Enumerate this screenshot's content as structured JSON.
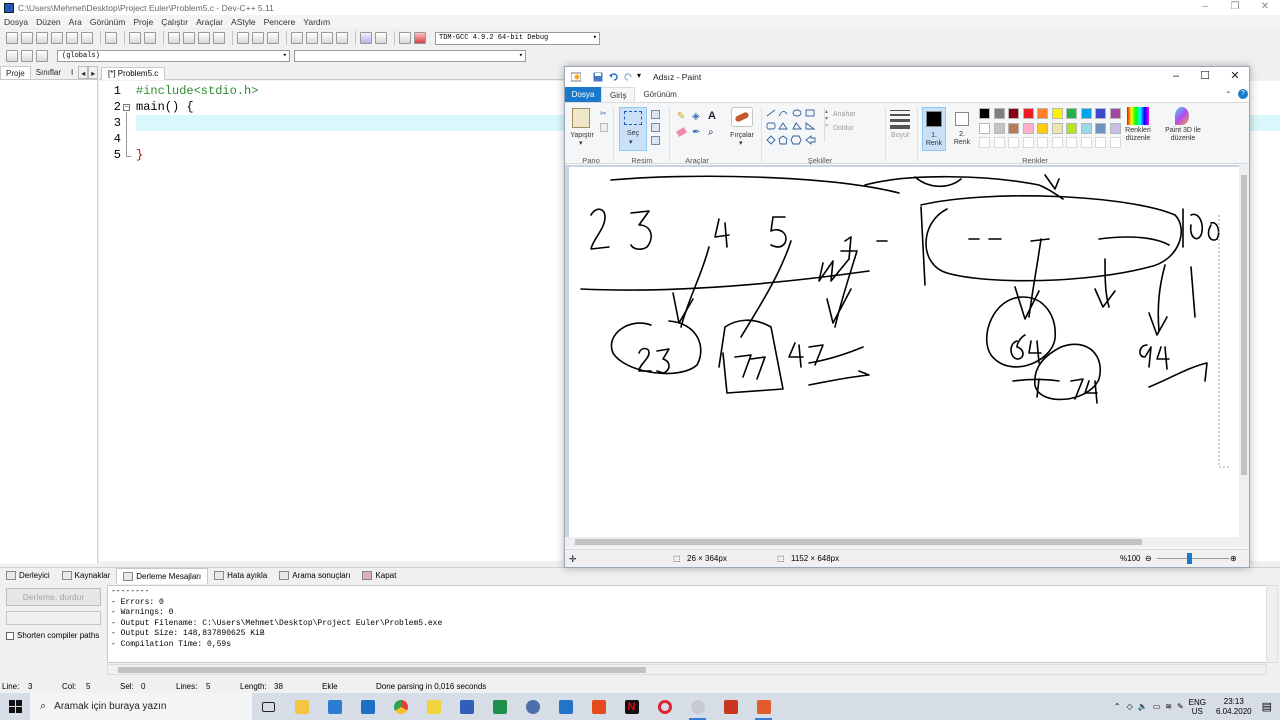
{
  "devcpp": {
    "title": "C:\\Users\\Mehmet\\Desktop\\Project Euler\\Problem5.c - Dev-C++ 5.11",
    "menu": [
      "Dosya",
      "Düzen",
      "Ara",
      "Görünüm",
      "Proje",
      "Çalıştır",
      "Araçlar",
      "AStyle",
      "Pencere",
      "Yardım"
    ],
    "compiler": "TDM-GCC 4.9.2 64-bit Debug",
    "scope_combo": "(globals)",
    "left_tabs": [
      "Proje",
      "Sınıflar",
      "I"
    ],
    "editor_tab": "[*] Problem5.c",
    "code_lines": [
      {
        "num": "1",
        "text": "#include<stdio.h>"
      },
      {
        "num": "2",
        "text": "main() {"
      },
      {
        "num": "3",
        "text": ""
      },
      {
        "num": "4",
        "text": ""
      },
      {
        "num": "5",
        "text": "}"
      }
    ],
    "bottom_tabs": [
      "Derleyici",
      "Kaynaklar",
      "Derleme Mesajları",
      "Hata ayıkla",
      "Arama sonuçları",
      "Kapat"
    ],
    "stop_button": "Derleme, durdur",
    "shorten_paths": "Shorten compiler paths",
    "output_lines": [
      "--------",
      "- Errors: 0",
      "- Warnings: 0",
      "- Output Filename: C:\\Users\\Mehmet\\Desktop\\Project Euler\\Problem5.exe",
      "- Output Size: 148,837890625 KiB",
      "- Compilation Time: 0,59s"
    ],
    "status": {
      "line_label": "Line:",
      "line": "3",
      "col_label": "Col:",
      "col": "5",
      "sel_label": "Sel:",
      "sel": "0",
      "lines_label": "Lines:",
      "lines": "5",
      "length_label": "Length:",
      "length": "38",
      "mode": "Ekle",
      "message": "Done parsing in 0,016 seconds"
    }
  },
  "paint": {
    "title": "Adsız - Paint",
    "tabs": [
      "Dosya",
      "Giriş",
      "Görünüm"
    ],
    "groups": {
      "pano": "Pano",
      "resim": "Resim",
      "araclar": "Araçlar",
      "sekiller": "Şekiller",
      "renkler": "Renkler"
    },
    "buttons": {
      "paste": "Yapıştır",
      "select": "Seç",
      "brushes": "Fırçalar",
      "outline": "Anahat",
      "fill": "Doldur",
      "size": "Boyut",
      "color1": "1.\nRenk",
      "color2": "2.\nRenk",
      "edit_colors": "Renkleri\ndüzenle",
      "paint3d": "Paint 3D ile\ndüzenle"
    },
    "status": {
      "cursor": "26 × 364px",
      "size": "1152 × 648px",
      "zoom": "%100"
    },
    "palette": [
      "#000000",
      "#7f7f7f",
      "#880015",
      "#ed1c24",
      "#ff7f27",
      "#fff200",
      "#22b14c",
      "#00a2e8",
      "#3f48cc",
      "#a349a4",
      "#ffffff",
      "#c3c3c3",
      "#b97a57",
      "#ffaec9",
      "#ffc90e",
      "#efe4b0",
      "#b5e61d",
      "#99d9ea",
      "#7092be",
      "#c8bfe7"
    ],
    "drawing_text": [
      "2",
      "3",
      "4",
      "5",
      "100",
      "23",
      "37",
      "47",
      "64",
      "74",
      "94"
    ]
  },
  "taskbar": {
    "search": "Aramak için buraya yazın",
    "lang": "ENG",
    "locale": "US",
    "time": "23:13",
    "date": "6.04.2020"
  }
}
